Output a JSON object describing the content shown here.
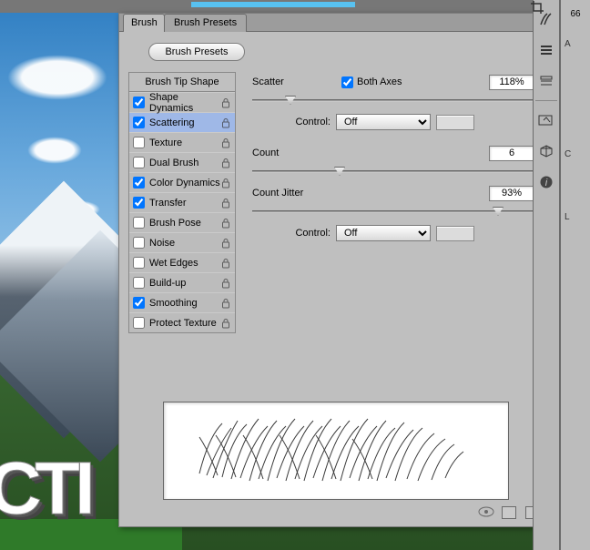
{
  "topValue": "66",
  "tabs": {
    "brush": "Brush",
    "presets": "Brush Presets"
  },
  "presetsButton": "Brush Presets",
  "optionsHeader": "Brush Tip Shape",
  "options": [
    {
      "label": "Shape Dynamics",
      "checked": true,
      "selected": false
    },
    {
      "label": "Scattering",
      "checked": true,
      "selected": true
    },
    {
      "label": "Texture",
      "checked": false,
      "selected": false
    },
    {
      "label": "Dual Brush",
      "checked": false,
      "selected": false
    },
    {
      "label": "Color Dynamics",
      "checked": true,
      "selected": false
    },
    {
      "label": "Transfer",
      "checked": true,
      "selected": false
    },
    {
      "label": "Brush Pose",
      "checked": false,
      "selected": false
    },
    {
      "label": "Noise",
      "checked": false,
      "selected": false
    },
    {
      "label": "Wet Edges",
      "checked": false,
      "selected": false
    },
    {
      "label": "Build-up",
      "checked": false,
      "selected": false
    },
    {
      "label": "Smoothing",
      "checked": true,
      "selected": false
    },
    {
      "label": "Protect Texture",
      "checked": false,
      "selected": false
    }
  ],
  "settings": {
    "scatter": {
      "label": "Scatter",
      "value": "118%",
      "bothAxesLabel": "Both Axes",
      "bothAxesChecked": true,
      "thumb": 12,
      "controlLabel": "Control:",
      "controlValue": "Off"
    },
    "count": {
      "label": "Count",
      "value": "6",
      "thumb": 30
    },
    "countJitter": {
      "label": "Count Jitter",
      "value": "93%",
      "thumb": 88,
      "controlLabel": "Control:",
      "controlValue": "Off"
    }
  },
  "rightLabels": {
    "a": "A",
    "c": "C",
    "l": "L"
  },
  "text3d": "ІСТІ"
}
